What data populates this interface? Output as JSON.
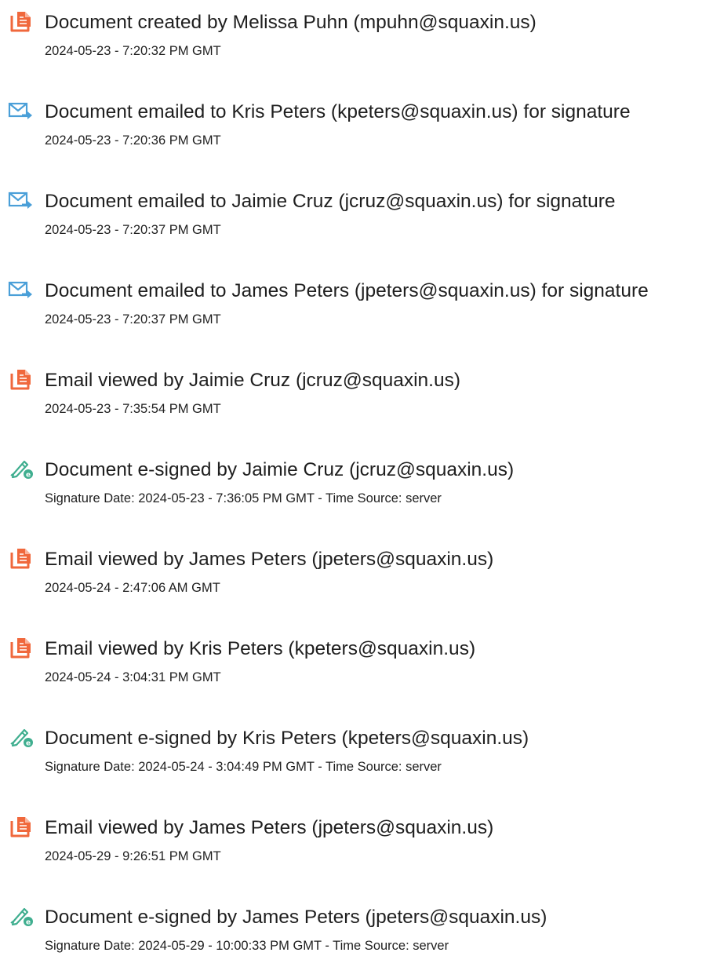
{
  "events": [
    {
      "icon": "document-icon",
      "title": "Document created by Melissa Puhn (mpuhn@squaxin.us)",
      "date": "2024-05-23 - 7:20:32 PM GMT"
    },
    {
      "icon": "email-sent-icon",
      "title": "Document emailed to Kris Peters (kpeters@squaxin.us) for signature",
      "date": "2024-05-23 - 7:20:36 PM GMT"
    },
    {
      "icon": "email-sent-icon",
      "title": "Document emailed to Jaimie Cruz (jcruz@squaxin.us) for signature",
      "date": "2024-05-23 - 7:20:37 PM GMT"
    },
    {
      "icon": "email-sent-icon",
      "title": "Document emailed to James Peters (jpeters@squaxin.us) for signature",
      "date": "2024-05-23 - 7:20:37 PM GMT"
    },
    {
      "icon": "document-icon",
      "title": "Email viewed by Jaimie Cruz (jcruz@squaxin.us)",
      "date": "2024-05-23 - 7:35:54 PM GMT"
    },
    {
      "icon": "esign-pen-icon",
      "title": "Document e-signed by Jaimie Cruz (jcruz@squaxin.us)",
      "date": "Signature Date: 2024-05-23 - 7:36:05 PM GMT - Time Source: server"
    },
    {
      "icon": "document-icon",
      "title": "Email viewed by James Peters (jpeters@squaxin.us)",
      "date": "2024-05-24 - 2:47:06 AM GMT"
    },
    {
      "icon": "document-icon",
      "title": "Email viewed by Kris Peters (kpeters@squaxin.us)",
      "date": "2024-05-24 - 3:04:31 PM GMT"
    },
    {
      "icon": "esign-pen-icon",
      "title": "Document e-signed by Kris Peters (kpeters@squaxin.us)",
      "date": "Signature Date: 2024-05-24 - 3:04:49 PM GMT - Time Source: server"
    },
    {
      "icon": "document-icon",
      "title": "Email viewed by James Peters (jpeters@squaxin.us)",
      "date": "2024-05-29 - 9:26:51 PM GMT"
    },
    {
      "icon": "esign-pen-icon",
      "title": "Document e-signed by James Peters (jpeters@squaxin.us)",
      "date": "Signature Date: 2024-05-29 - 10:00:33 PM GMT - Time Source: server"
    }
  ],
  "colors": {
    "document_icon": "#f0683c",
    "email_icon": "#4a9fd8",
    "esign_icon": "#3fae8f"
  }
}
